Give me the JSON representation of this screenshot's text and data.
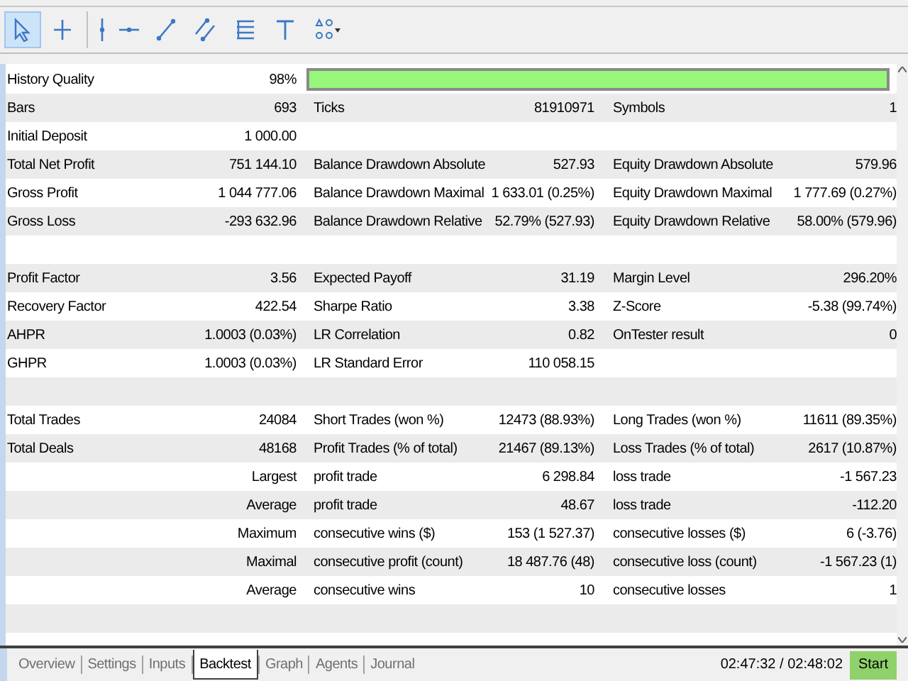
{
  "toolbar": {
    "tools": [
      {
        "kind": "cursor",
        "selected": true
      },
      {
        "kind": "crosshair",
        "selected": false
      },
      {
        "kind": "separator"
      },
      {
        "kind": "vline",
        "selected": false
      },
      {
        "kind": "hline",
        "selected": false
      },
      {
        "kind": "trend",
        "selected": false
      },
      {
        "kind": "channel",
        "selected": false
      },
      {
        "kind": "fibo",
        "selected": false
      },
      {
        "kind": "text",
        "selected": false
      },
      {
        "kind": "shapes",
        "selected": false
      }
    ]
  },
  "report": {
    "rows": [
      {
        "kind": "quality",
        "cells": [
          "History Quality",
          "98%"
        ]
      },
      {
        "kind": "main",
        "cells": [
          "Bars",
          "693",
          "Ticks",
          "81910971",
          "Symbols",
          "1"
        ]
      },
      {
        "kind": "main",
        "cells": [
          "Initial Deposit",
          "1 000.00"
        ]
      },
      {
        "kind": "main",
        "cells": [
          "Total Net Profit",
          "751 144.10",
          "Balance Drawdown Absolute",
          "527.93",
          "Equity Drawdown Absolute",
          "579.96"
        ]
      },
      {
        "kind": "main",
        "cells": [
          "Gross Profit",
          "1 044 777.06",
          "Balance Drawdown Maximal",
          "1 633.01 (0.25%)",
          "Equity Drawdown Maximal",
          "1 777.69 (0.27%)"
        ]
      },
      {
        "kind": "main",
        "cells": [
          "Gross Loss",
          "-293 632.96",
          "Balance Drawdown Relative",
          "52.79% (527.93)",
          "Equity Drawdown Relative",
          "58.00% (579.96)"
        ]
      },
      {
        "kind": "blank",
        "cells": []
      },
      {
        "kind": "main",
        "cells": [
          "Profit Factor",
          "3.56",
          "Expected Payoff",
          "31.19",
          "Margin Level",
          "296.20%"
        ]
      },
      {
        "kind": "main",
        "cells": [
          "Recovery Factor",
          "422.54",
          "Sharpe Ratio",
          "3.38",
          "Z-Score",
          "-5.38 (99.74%)"
        ]
      },
      {
        "kind": "main",
        "cells": [
          "AHPR",
          "1.0003 (0.03%)",
          "LR Correlation",
          "0.82",
          "OnTester result",
          "0"
        ]
      },
      {
        "kind": "main",
        "cells": [
          "GHPR",
          "1.0003 (0.03%)",
          "LR Standard Error",
          "110 058.15"
        ]
      },
      {
        "kind": "blank",
        "cells": []
      },
      {
        "kind": "main",
        "cells": [
          "Total Trades",
          "24084",
          "Short Trades (won %)",
          "12473 (88.93%)",
          "Long Trades (won %)",
          "11611 (89.35%)"
        ]
      },
      {
        "kind": "main",
        "cells": [
          "Total Deals",
          "48168",
          "Profit Trades (% of total)",
          "21467 (89.13%)",
          "Loss Trades (% of total)",
          "2617 (10.87%)"
        ]
      },
      {
        "kind": "sub",
        "cells": [
          "Largest",
          "profit trade",
          "6 298.84",
          "loss trade",
          "-1 567.23"
        ]
      },
      {
        "kind": "sub",
        "cells": [
          "Average",
          "profit trade",
          "48.67",
          "loss trade",
          "-112.20"
        ]
      },
      {
        "kind": "sub",
        "cells": [
          "Maximum",
          "consecutive wins ($)",
          "153 (1 527.37)",
          "consecutive losses ($)",
          "6 (-3.76)"
        ]
      },
      {
        "kind": "sub",
        "cells": [
          "Maximal",
          "consecutive profit (count)",
          "18 487.76 (48)",
          "consecutive loss (count)",
          "-1 567.23 (1)"
        ]
      },
      {
        "kind": "sub",
        "cells": [
          "Average",
          "consecutive wins",
          "10",
          "consecutive losses",
          "1"
        ]
      },
      {
        "kind": "blank",
        "cells": []
      }
    ]
  },
  "tabs": [
    {
      "label": "Overview",
      "selected": false
    },
    {
      "label": "Settings",
      "selected": false
    },
    {
      "label": "Inputs",
      "selected": false
    },
    {
      "label": "Backtest",
      "selected": true
    },
    {
      "label": "Graph",
      "selected": false
    },
    {
      "label": "Agents",
      "selected": false
    },
    {
      "label": "Journal",
      "selected": false
    }
  ],
  "status": {
    "time": "02:47:32 / 02:48:02",
    "start_button": "Start"
  }
}
